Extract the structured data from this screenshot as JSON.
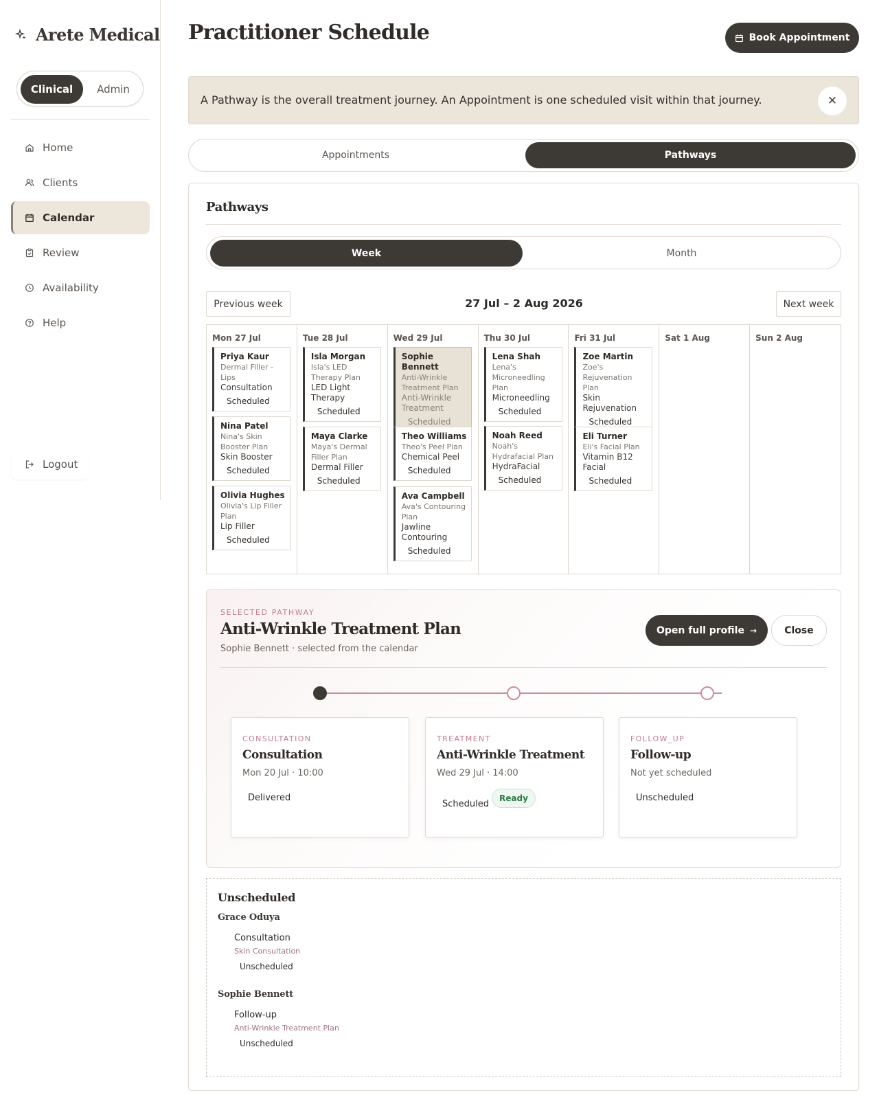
{
  "brand": {
    "name": "Arete Medical"
  },
  "mode_switch": {
    "active": "Clinical",
    "inactive": "Admin"
  },
  "nav": {
    "items": [
      {
        "label": "Home",
        "icon": "home-icon"
      },
      {
        "label": "Clients",
        "icon": "users-icon"
      },
      {
        "label": "Calendar",
        "icon": "calendar-icon",
        "active": true
      },
      {
        "label": "Review",
        "icon": "clipboard-icon"
      },
      {
        "label": "Availability",
        "icon": "clock-icon"
      },
      {
        "label": "Help",
        "icon": "help-icon"
      }
    ],
    "logout": "Logout"
  },
  "header": {
    "title": "Practitioner Schedule",
    "book_label": "Book Appointment"
  },
  "banner": {
    "text": "A Pathway is the overall treatment journey. An Appointment is one scheduled visit within that journey.",
    "close_icon": "close-icon"
  },
  "tabs": {
    "appointments": "Appointments",
    "pathways": "Pathways",
    "active": "Pathways"
  },
  "pathways": {
    "title": "Pathways",
    "view": {
      "week": "Week",
      "month": "Month",
      "active": "Week"
    },
    "prev_label": "Previous week",
    "next_label": "Next week",
    "range": "27 Jul – 2 Aug 2026"
  },
  "calendar": {
    "days": [
      {
        "label": "Mon 27 Jul",
        "cards": [
          {
            "client": "Priya Kaur",
            "plan": "Dermal Filler - Lips",
            "treatment": "Consultation",
            "status": "Scheduled"
          },
          {
            "client": "Nina Patel",
            "plan": "Nina's Skin Booster Plan",
            "treatment": "Skin Booster",
            "status": "Scheduled"
          },
          {
            "client": "Olivia Hughes",
            "plan": "Olivia's Lip Filler Plan",
            "treatment": "Lip Filler",
            "status": "Scheduled"
          }
        ]
      },
      {
        "label": "Tue 28 Jul",
        "cards": [
          {
            "client": "Isla Morgan",
            "plan": "Isla's LED Therapy Plan",
            "treatment": "LED Light Therapy",
            "status": "Scheduled"
          },
          {
            "client": "Maya Clarke",
            "plan": "Maya's Dermal Filler Plan",
            "treatment": "Dermal Filler",
            "status": "Scheduled"
          }
        ]
      },
      {
        "label": "Wed 29 Jul",
        "cards": [
          {
            "client": "Sophie Bennett",
            "plan": "Anti-Wrinkle Treatment Plan",
            "treatment": "Anti-Wrinkle Treatment",
            "status": "Scheduled",
            "selected": true
          },
          {
            "client": "Theo Williams",
            "plan": "Theo's Peel Plan",
            "treatment": "Chemical Peel",
            "status": "Scheduled"
          },
          {
            "client": "Ava Campbell",
            "plan": "Ava's Contouring Plan",
            "treatment": "Jawline Contouring",
            "status": "Scheduled"
          }
        ]
      },
      {
        "label": "Thu 30 Jul",
        "cards": [
          {
            "client": "Lena Shah",
            "plan": "Lena's Microneedling Plan",
            "treatment": "Microneedling",
            "status": "Scheduled"
          },
          {
            "client": "Noah Reed",
            "plan": "Noah's Hydrafacial Plan",
            "treatment": "HydraFacial",
            "status": "Scheduled"
          }
        ]
      },
      {
        "label": "Fri 31 Jul",
        "cards": [
          {
            "client": "Zoe Martin",
            "plan": "Zoe's Rejuvenation Plan",
            "treatment": "Skin Rejuvenation",
            "status": "Scheduled"
          },
          {
            "client": "Eli Turner",
            "plan": "Eli's Facial Plan",
            "treatment": "Vitamin B12 Facial",
            "status": "Scheduled"
          }
        ]
      },
      {
        "label": "Sat 1 Aug",
        "cards": []
      },
      {
        "label": "Sun 2 Aug",
        "cards": []
      }
    ]
  },
  "selected": {
    "eyebrow": "SELECTED PATHWAY",
    "title": "Anti-Wrinkle Treatment Plan",
    "subtitle": "Sophie Bennett · selected from the calendar",
    "open_label": "Open full profile",
    "open_arrow": "→",
    "close_label": "Close",
    "steps": [
      {
        "eyebrow": "CONSULTATION",
        "title": "Consultation",
        "when": "Mon 20 Jul · 10:00",
        "status": "Delivered"
      },
      {
        "eyebrow": "TREATMENT",
        "title": "Anti-Wrinkle Treatment",
        "when": "Wed 29 Jul · 14:00",
        "status": "Scheduled",
        "badge": "Ready"
      },
      {
        "eyebrow": "FOLLOW_UP",
        "title": "Follow-up",
        "when": "Not yet scheduled",
        "status": "Unscheduled"
      }
    ]
  },
  "unscheduled": {
    "title": "Unscheduled",
    "groups": [
      {
        "client": "Grace Oduya",
        "treatment": "Consultation",
        "plan": "Skin Consultation",
        "status": "Unscheduled"
      },
      {
        "client": "Sophie Bennett",
        "treatment": "Follow-up",
        "plan": "Anti-Wrinkle Treatment Plan",
        "status": "Unscheduled"
      }
    ]
  },
  "colors": {
    "primary": "#3d3935",
    "accent": "#c07c8e",
    "success": "#2a7a45",
    "banner": "#ebe5da"
  }
}
